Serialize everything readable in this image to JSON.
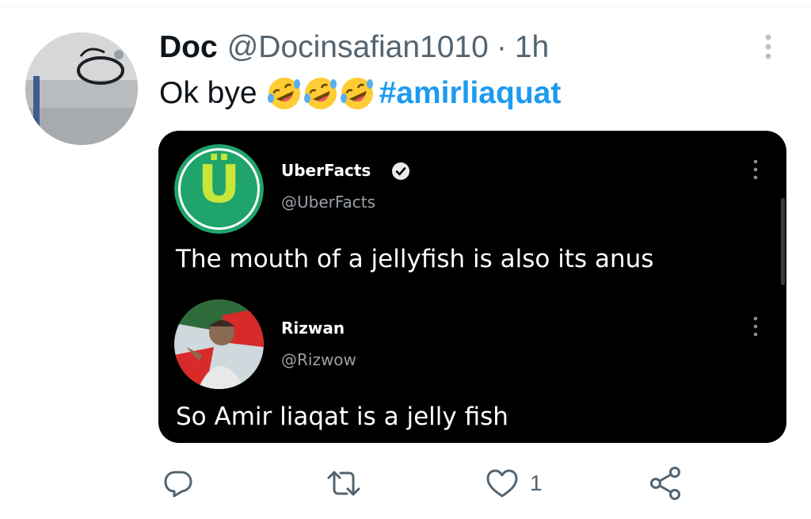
{
  "tweet": {
    "author_name": "Doc",
    "author_handle": "@Docinsafian1010",
    "separator": "·",
    "time": "1h",
    "text_prefix": "Ok bye",
    "emoji_names": [
      "rolling-on-floor-laughing-emoji",
      "rolling-on-floor-laughing-emoji",
      "rolling-on-floor-laughing-emoji"
    ],
    "hashtag": "#amirliaquat"
  },
  "embedded_screenshot": {
    "post1": {
      "name": "UberFacts",
      "handle": "@UberFacts",
      "verified": true,
      "avatar_letter": "Ü",
      "text": "The mouth of a jellyfish is also its anus"
    },
    "post2": {
      "name": "Rizwan",
      "handle": "@Rizwow",
      "text": "So Amir liaqat is a jelly fish"
    }
  },
  "actions": {
    "reply_icon": "reply-icon",
    "retweet_icon": "retweet-icon",
    "like_icon": "heart-icon",
    "like_count": "1",
    "share_icon": "share-icon"
  },
  "colors": {
    "hashtag": "#1d9bf0",
    "secondary_text": "#536471",
    "card_bg": "#000000",
    "uberfacts_green": "#1fa46b",
    "uberfacts_lime": "#c6e63a"
  }
}
